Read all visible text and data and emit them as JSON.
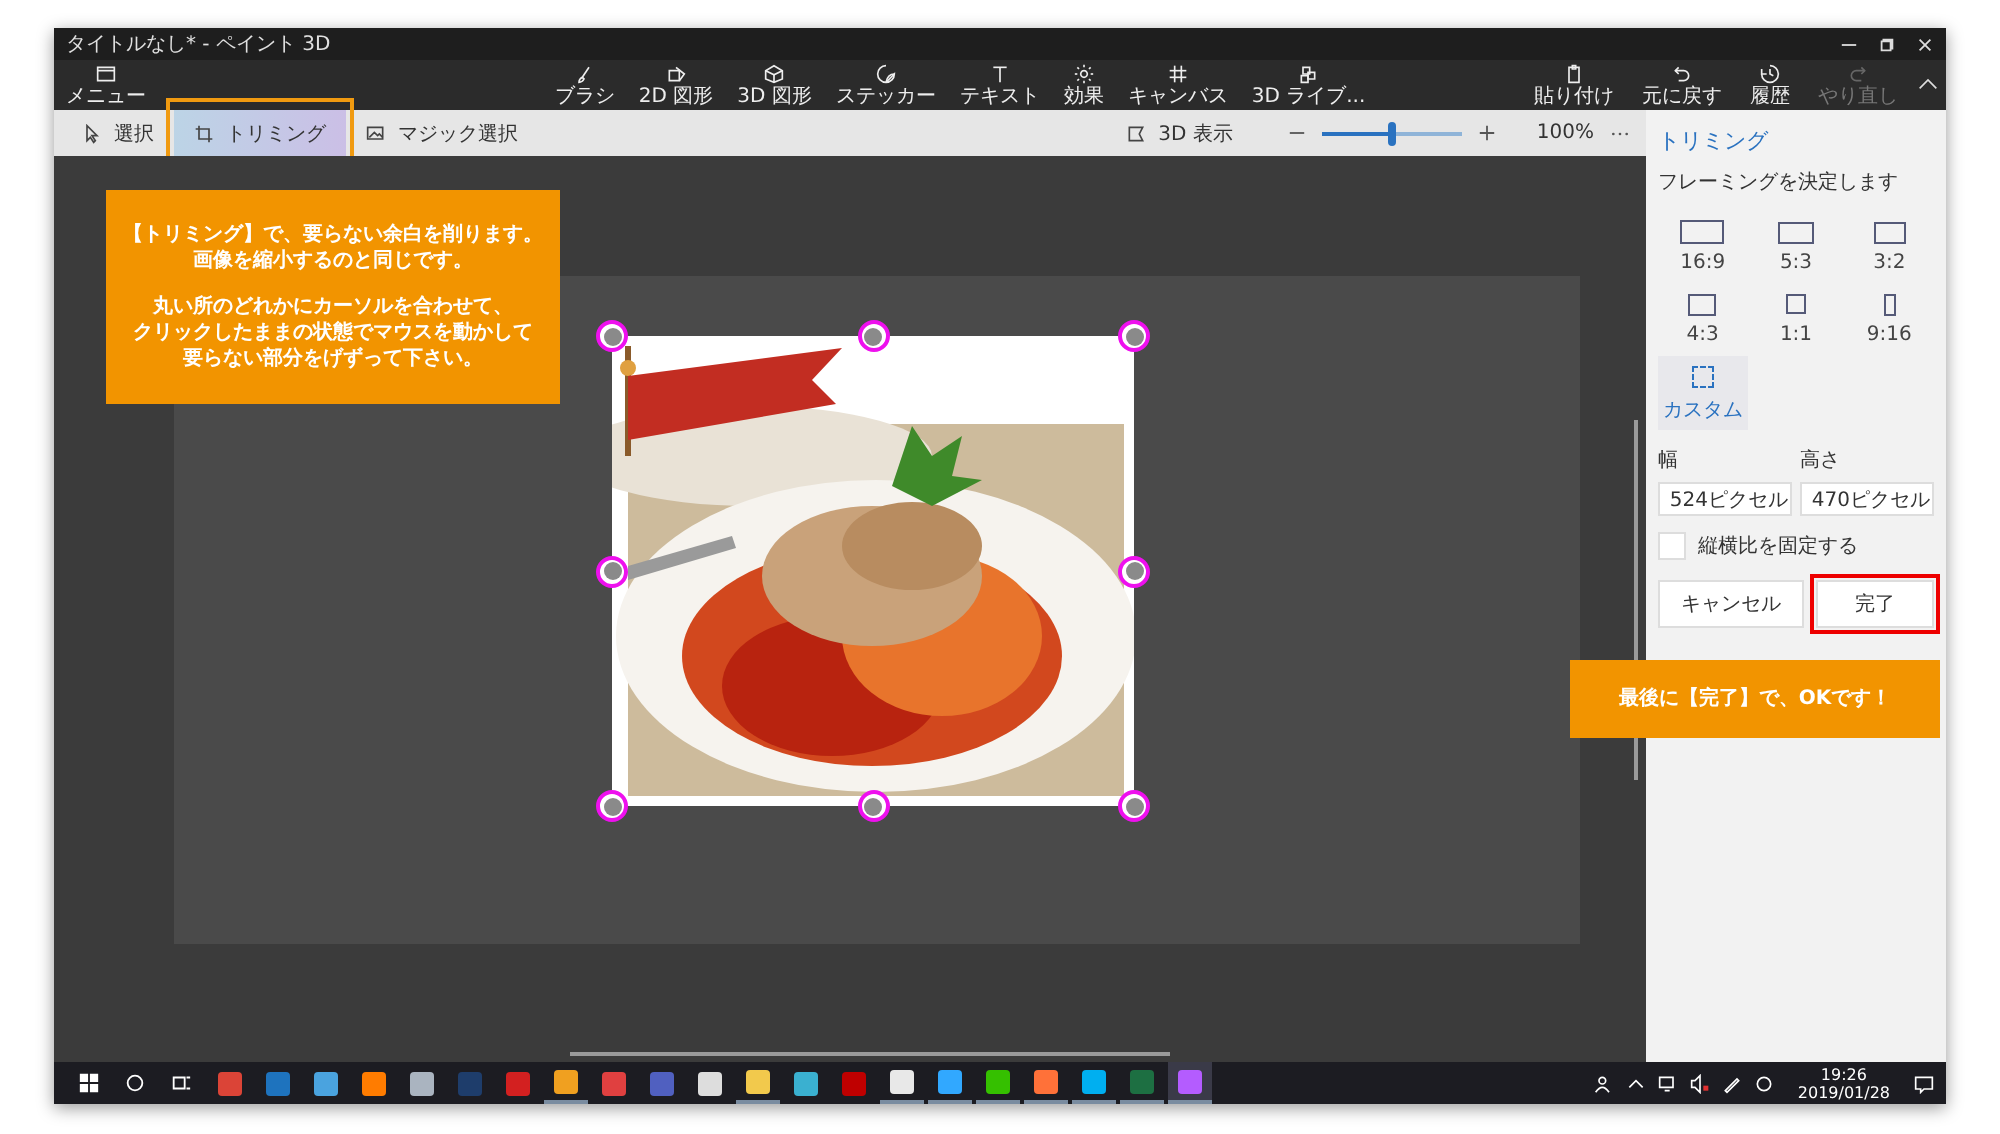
{
  "window": {
    "title": "タイトルなし* - ペイント 3D"
  },
  "ribbon": {
    "menu": "メニュー",
    "tools": [
      {
        "label": "ブラシ"
      },
      {
        "label": "2D 図形"
      },
      {
        "label": "3D 図形"
      },
      {
        "label": "ステッカー"
      },
      {
        "label": "テキスト"
      },
      {
        "label": "効果"
      },
      {
        "label": "キャンバス"
      },
      {
        "label": "3D ライブ..."
      }
    ],
    "actions": [
      {
        "label": "貼り付け",
        "disabled": false
      },
      {
        "label": "元に戻す",
        "disabled": false
      },
      {
        "label": "履歴",
        "disabled": false
      },
      {
        "label": "やり直し",
        "disabled": true
      }
    ]
  },
  "toolbar": {
    "modes": [
      {
        "label": "選択",
        "selected": false
      },
      {
        "label": "トリミング",
        "selected": true
      },
      {
        "label": "マジック選択",
        "selected": false
      }
    ],
    "view_3d": "3D 表示",
    "zoom": {
      "level": 0.5,
      "reading": "100%"
    }
  },
  "panel": {
    "title": "トリミング",
    "subtitle": "フレーミングを決定します",
    "ratios": [
      {
        "kind": "ratio",
        "label": "16:9",
        "selected": false
      },
      {
        "kind": "ratio",
        "label": "5:3",
        "selected": false
      },
      {
        "kind": "ratio",
        "label": "3:2",
        "selected": false
      },
      {
        "kind": "ratio",
        "label": "4:3",
        "selected": false
      },
      {
        "kind": "ratio",
        "label": "1:1",
        "selected": false
      },
      {
        "kind": "ratio",
        "label": "9:16",
        "selected": false
      },
      {
        "kind": "custom",
        "label": "カスタム",
        "selected": true
      }
    ],
    "width": {
      "label": "幅",
      "value": "524ピクセル"
    },
    "height": {
      "label": "高さ",
      "value": "470ピクセル"
    },
    "lock_aspect": {
      "label": "縦横比を固定する",
      "checked": false
    },
    "cancel": "キャンセル",
    "done": "完了"
  },
  "callouts": [
    {
      "paragraphs": [
        [
          "【トリミング】で、要らない余白を削ります。",
          "画像を縮小するのと同じです。"
        ],
        [
          "丸い所のどれかにカーソルを合わせて、",
          "クリックしたままの状態でマウスを動かして",
          "要らない部分をげずって下さい。"
        ]
      ]
    },
    {
      "paragraphs": [
        [
          "最後に【完了】で、OKです！"
        ]
      ]
    }
  ],
  "taskbar": {
    "apps": [
      {
        "color": "#db4437",
        "active": false
      },
      {
        "color": "#1e73be",
        "active": false
      },
      {
        "color": "#4aa3df",
        "active": false
      },
      {
        "color": "#ff7c00",
        "active": false
      },
      {
        "color": "#aab4c0",
        "active": false
      },
      {
        "color": "#1e3d6b",
        "active": false
      },
      {
        "color": "#d32020",
        "active": false
      },
      {
        "color": "#f0a020",
        "active": true
      },
      {
        "color": "#e04040",
        "active": false
      },
      {
        "color": "#5060c0",
        "active": false
      },
      {
        "color": "#dddddd",
        "active": false
      },
      {
        "color": "#f2c94c",
        "active": true
      },
      {
        "color": "#3ab0d0",
        "active": false
      },
      {
        "color": "#bf0000",
        "active": false
      },
      {
        "color": "#e8e8e8",
        "active": true
      },
      {
        "color": "#31a8ff",
        "active": true
      },
      {
        "color": "#35c000",
        "active": true
      },
      {
        "color": "#ff7139",
        "active": true
      },
      {
        "color": "#00aff0",
        "active": true
      },
      {
        "color": "#1d6f42",
        "active": true
      },
      {
        "color": "#b45cff",
        "active": true
      }
    ],
    "time": "19:26",
    "date": "2019/01/28"
  }
}
